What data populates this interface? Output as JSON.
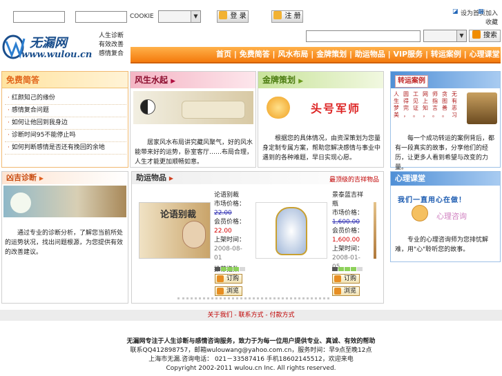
{
  "topbar": {
    "cookie_label": "COOKIE",
    "login_label": "登 录",
    "register_label": "注 册",
    "link_home": "设为首页",
    "link_fav": "加入收藏"
  },
  "header": {
    "logo_text": "无漏网",
    "logo_domain": "www.wulou.cn",
    "slogan_lines": [
      "人生诊断",
      "有效改善",
      "感情复合"
    ],
    "search_label": "搜索"
  },
  "nav": {
    "items": [
      "首页",
      "免费简答",
      "风水布局",
      "金牌策划",
      "助运物品",
      "VIP服务",
      "转运案例",
      "心理课堂"
    ],
    "separator": " | "
  },
  "panels": {
    "free": {
      "title": "免费简答",
      "items": [
        "红颜知己的缘份",
        "感情复合问题",
        "如何让他回到我身边",
        "诊断时间95不能停止吗",
        "如何判断感情是否还有挽回的余地"
      ]
    },
    "fengshui": {
      "title": "风生水起",
      "text": "居家风水布局讲究藏风聚气，好的风水能带来好的运势，卧室客厅……布局合理，人生才能更加顺畅如意。"
    },
    "strategy": {
      "title": "金牌策划",
      "banner": "头号军师",
      "text": "根据您的具体情况，由资深策划为您量身定制专属方案，帮助您解决感情与事业中遇到的各种难题，早日实现心愿。"
    },
    "cases": {
      "title": "转运案例",
      "grid": [
        "人",
        "圆",
        "工",
        "网",
        "师",
        "贪",
        "无",
        "生",
        "得",
        "见",
        "上",
        "指",
        "图",
        "有",
        "梦",
        "完",
        "证",
        "知",
        "言",
        "善",
        "恶",
        "美",
        "，",
        "。",
        "，",
        "。",
        "。",
        "习"
      ],
      "text": "每一个成功转运的案例背后，都有一段真实的故事，分享他们的经历，让更多人看到希望与改变的力量。"
    },
    "diagnose": {
      "title": "凶吉诊断",
      "text": "通过专业的诊断分析，了解您当前所处的运势状况，找出问题根源，为您提供有效的改善建议。"
    },
    "goods": {
      "title": "助运物品",
      "tag": "最顶级的吉祥物品",
      "products": [
        {
          "name": "论语别裁",
          "orig_label": "市场价格：",
          "orig_price": "22.00",
          "price_label": "会员价格：",
          "price": "22.00",
          "date_label": "上架时间：",
          "date": "2008-08-01",
          "rating_label": "推荐指数",
          "buy": "订购",
          "view": "浏览"
        },
        {
          "name": "景泰蓝吉祥瓶",
          "orig_label": "市场价格：",
          "orig_price": "1,600.00",
          "price_label": "会员价格：",
          "price": "1,600.00",
          "date_label": "上架时间：",
          "date": "2008-01-05",
          "rating_label": "推荐指数",
          "buy": "订购",
          "view": "浏览"
        }
      ]
    },
    "psych": {
      "title": "心理课堂",
      "banner_top": "我们一直用心在做！",
      "banner_bottom": "心理咨询",
      "text": "专业的心理咨询师为您排忧解难，用\"心\"聆听您的故事。"
    }
  },
  "footer": {
    "links": "关于我们 - 联系方式 - 付款方式",
    "line1": "无漏网专注于人生诊断与感情咨询服务，致力于为每一位用户提供专业、真诚、有效的帮助",
    "line2": "联系QQ412898757，邮箱wulouwang@yahoo.com.cn，服务时间：早9点至晚12点",
    "line3": "上海市无漏.咨询电话： 021－33587416 手机18602145512，欢迎来电",
    "copyright": "Copyright 2002-2011 wulou.cn Inc. All rights reserved."
  }
}
